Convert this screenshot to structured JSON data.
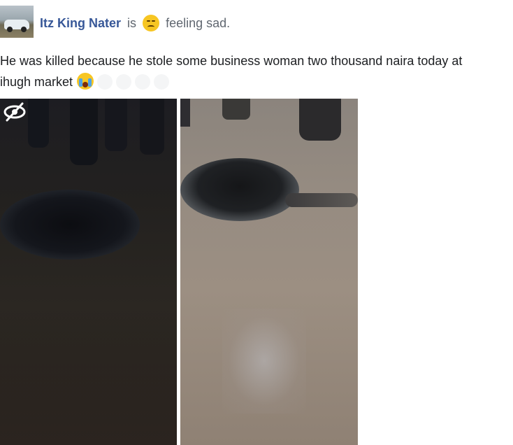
{
  "header": {
    "author": "Itz King Nater",
    "is_word": "is",
    "feeling_text": "feeling sad."
  },
  "post": {
    "line1": "He was killed because he stole some business woman two thousand naira today at",
    "line2": "ihugh market"
  },
  "icons": {
    "feeling": "sad-face-emoji",
    "reaction": "crying-face-emoji",
    "photo_overlay": "hidden-eye-icon"
  },
  "colors": {
    "author_link": "#385898",
    "secondary_text": "#606770",
    "body_text": "#1c1e21"
  }
}
